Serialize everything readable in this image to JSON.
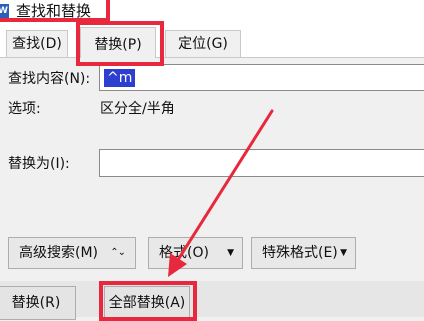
{
  "window": {
    "title": "查找和替换",
    "icon_letter": "W"
  },
  "tabs": [
    {
      "label": "查找(D)"
    },
    {
      "label": "替换(P)"
    },
    {
      "label": "定位(G)"
    }
  ],
  "find": {
    "label": "查找内容(N):",
    "value": "^m"
  },
  "options": {
    "label": "选项:",
    "value": "区分全/半角"
  },
  "replace": {
    "label": "替换为(I):",
    "value": ""
  },
  "buttons": {
    "advanced": "高级搜索(M)",
    "format": "格式(O)",
    "special": "特殊格式(E)",
    "replace": "替换(R)",
    "replace_all": "全部替换(A)"
  },
  "colors": {
    "highlight": "#e8283c",
    "selection": "#2c3fd0"
  }
}
